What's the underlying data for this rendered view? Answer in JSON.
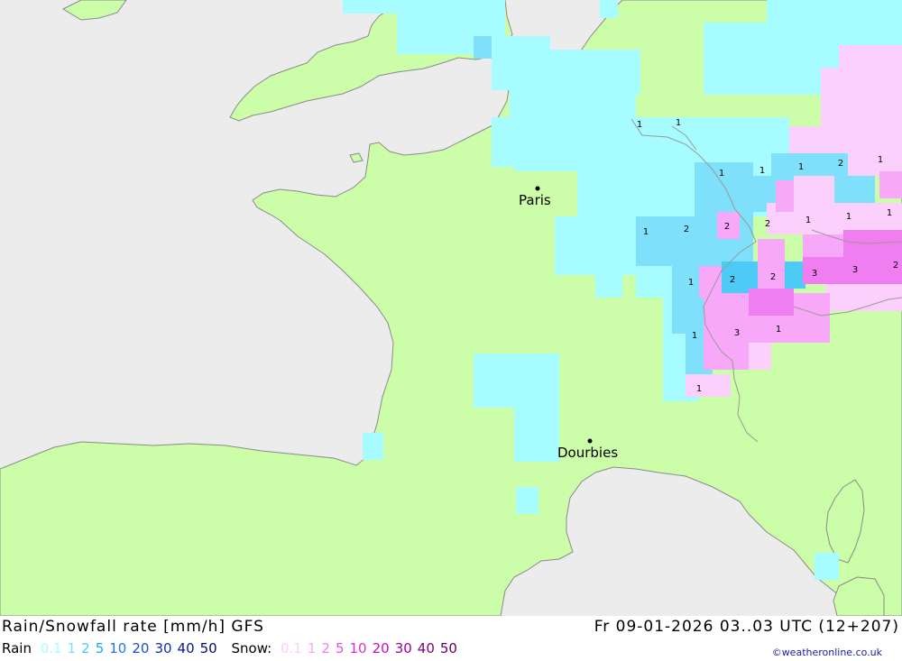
{
  "map": {
    "colors": {
      "sea": "#ececec",
      "land": "#ccfda8",
      "border": "#999999",
      "rain_light": "#a6fcff",
      "rain_1": "#7ee0fa",
      "rain_2": "#4ccbf6",
      "snow_light": "#fcd0fc",
      "snow_1": "#f8a8f8",
      "snow_2": "#f07ef0"
    },
    "cities": [
      {
        "name": "Paris"
      },
      {
        "name": "Dourbies"
      }
    ],
    "cell_values": [
      "1",
      "1",
      "1",
      "1",
      "1",
      "2",
      "1",
      "1",
      "2",
      "2",
      "2",
      "1",
      "1",
      "1",
      "1",
      "2",
      "2",
      "3",
      "3",
      "2",
      "1",
      "3",
      "1",
      "1"
    ]
  },
  "footer": {
    "title": "Rain/Snowfall rate [mm/h] GFS",
    "datetime": "Fr 09-01-2026 03..03 UTC (12+207)",
    "rain_label": "Rain",
    "rain_scale": [
      {
        "v": "0.1",
        "c": "#a6fcff"
      },
      {
        "v": "1",
        "c": "#7ee0fa"
      },
      {
        "v": "2",
        "c": "#4ccbf6"
      },
      {
        "v": "5",
        "c": "#20a8f0"
      },
      {
        "v": "10",
        "c": "#1e78f0"
      },
      {
        "v": "20",
        "c": "#1450d0"
      },
      {
        "v": "30",
        "c": "#0e2eb0"
      },
      {
        "v": "40",
        "c": "#0a1890"
      },
      {
        "v": "50",
        "c": "#060870"
      }
    ],
    "snow_label": "Snow:",
    "snow_scale": [
      {
        "v": "0.1",
        "c": "#fcd0fc"
      },
      {
        "v": "1",
        "c": "#f8a8f8"
      },
      {
        "v": "2",
        "c": "#f080f0"
      },
      {
        "v": "5",
        "c": "#e850e8"
      },
      {
        "v": "10",
        "c": "#d830d8"
      },
      {
        "v": "20",
        "c": "#c010c0"
      },
      {
        "v": "30",
        "c": "#a000a0"
      },
      {
        "v": "40",
        "c": "#800080"
      },
      {
        "v": "50",
        "c": "#600060"
      }
    ],
    "copyright": "©weatheronline.co.uk"
  }
}
